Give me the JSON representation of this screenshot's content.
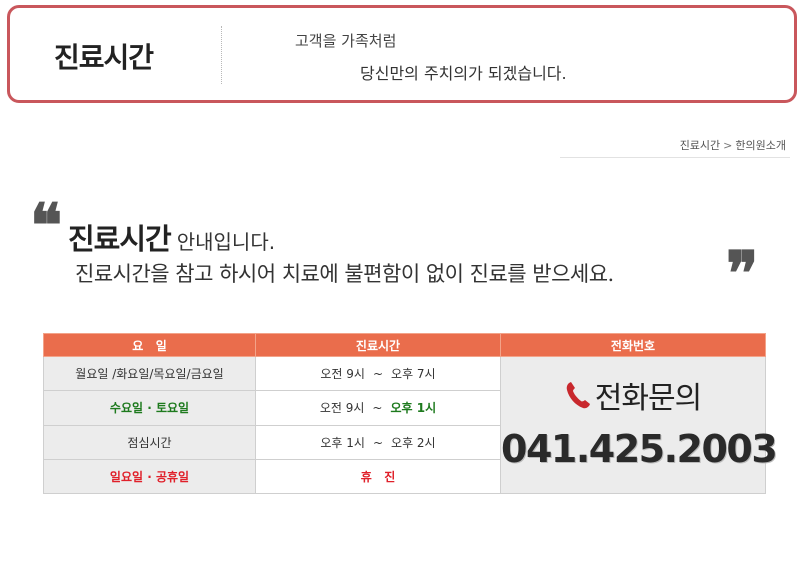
{
  "header": {
    "title": "진료시간",
    "slogan_line1": "고객을 가족처럼",
    "slogan_line2": "당신만의 주치의가 되겠습니다."
  },
  "breadcrumb": {
    "current": "진료시간",
    "separator": ">",
    "parent": "한의원소개"
  },
  "intro": {
    "heading_strong": "진료시간",
    "heading_rest": "안내입니다.",
    "subtitle": "진료시간을 참고 하시어 치료에 불편함이 없이 진료를 받으세요.",
    "quote_open": "❝",
    "quote_close": "❞"
  },
  "table": {
    "columns": [
      "요   일",
      "진료시간",
      "전화번호"
    ],
    "rows": [
      {
        "day": "월요일 /화요일/목요일/금요일",
        "start": "오전 9시",
        "tilde": "~",
        "end": "오후 7시",
        "style": "normal"
      },
      {
        "day": "수요일 · 토요일",
        "start": "오전 9시",
        "tilde": "~",
        "end": "오후 1시",
        "style": "green"
      },
      {
        "day": "점심시간",
        "start": "오후 1시",
        "tilde": "~",
        "end": "오후 2시",
        "style": "normal"
      },
      {
        "day": "일요일 · 공휴일",
        "hours": "휴   진",
        "style": "red"
      }
    ],
    "phone_label": "전화문의",
    "phone_number": "041.425.2003"
  },
  "colors": {
    "header_border": "#c9575c",
    "table_header": "#ea6d4c",
    "green_text": "#1e7a1e",
    "red_text": "#e0202a",
    "phone_icon": "#c8282d"
  }
}
